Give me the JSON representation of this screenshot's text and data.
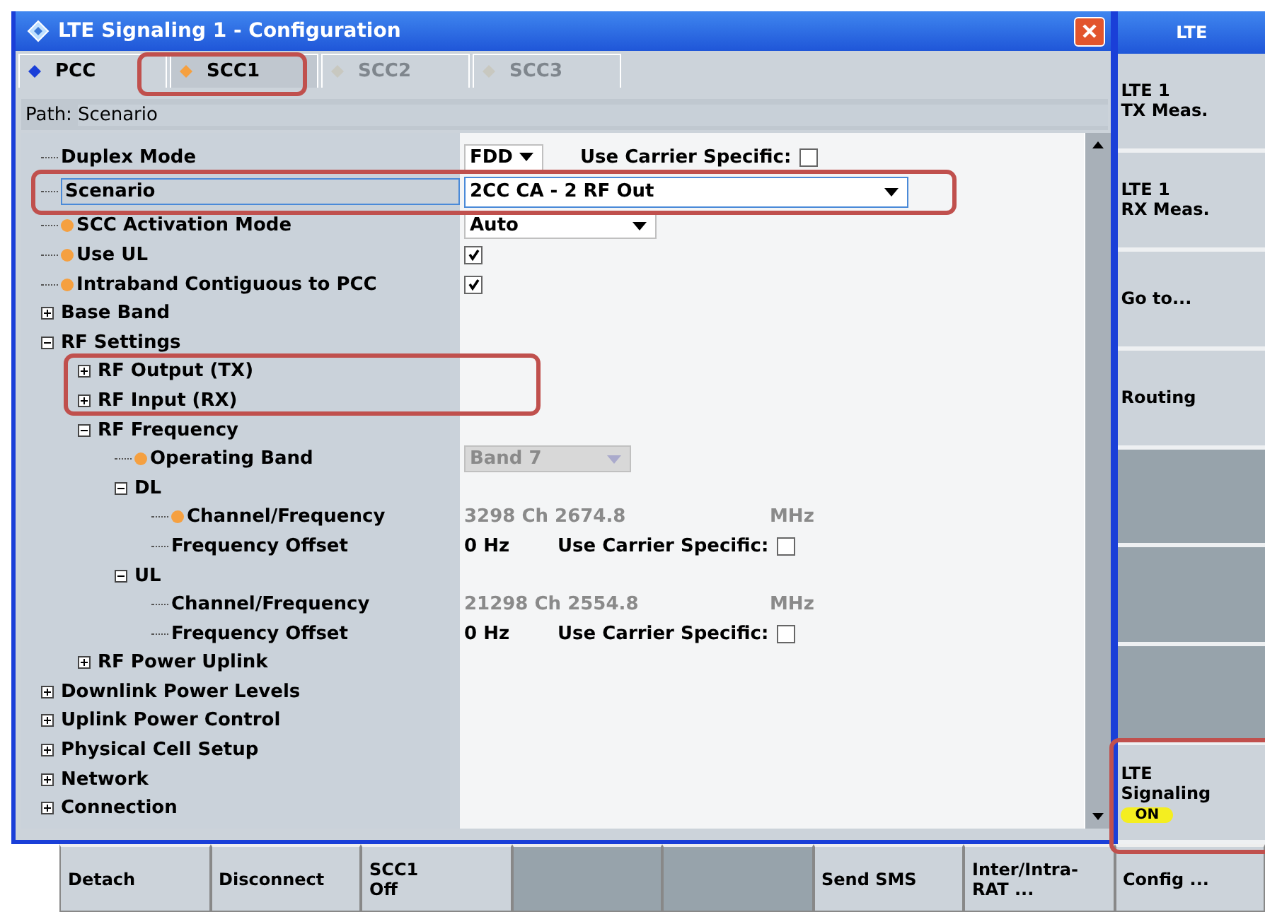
{
  "window": {
    "title": "LTE Signaling 1 - Configuration"
  },
  "tabs": [
    {
      "label": "PCC",
      "selected": false,
      "disabled": false,
      "color": "#1a3fd8"
    },
    {
      "label": "SCC1",
      "selected": true,
      "disabled": false,
      "color": "#f5a040"
    },
    {
      "label": "SCC2",
      "selected": false,
      "disabled": true,
      "color": "#c8c8c0"
    },
    {
      "label": "SCC3",
      "selected": false,
      "disabled": true,
      "color": "#c8c8c0"
    }
  ],
  "path": {
    "label": "Path:",
    "value": "Scenario"
  },
  "tree": [
    {
      "label": "Duplex Mode",
      "marked": false,
      "selected": false,
      "control": {
        "kind": "small-dropdown",
        "value": "FDD",
        "carrier_specific": {
          "label": "Use Carrier Specific:",
          "checked": false
        }
      }
    },
    {
      "label": "Scenario",
      "marked": false,
      "selected": true,
      "control": {
        "kind": "wide-dropdown",
        "value": "2CC CA - 2 RF Out"
      }
    },
    {
      "label": "SCC Activation Mode",
      "marked": true,
      "selected": false,
      "control": {
        "kind": "dropdown",
        "value": "Auto",
        "disabled": false
      }
    },
    {
      "label": "Use UL",
      "marked": true,
      "selected": false,
      "control": {
        "kind": "checkbox",
        "checked": true
      }
    },
    {
      "label": "Intraband Contiguous to PCC",
      "marked": true,
      "selected": false,
      "control": {
        "kind": "checkbox",
        "checked": true
      }
    },
    {
      "label": "Base Band",
      "marked": false,
      "selected": false,
      "expanded": false
    },
    {
      "label": "RF Settings",
      "marked": false,
      "selected": false,
      "expanded": true,
      "children": [
        {
          "label": "RF Output (TX)",
          "marked": false,
          "selected": false,
          "expanded": false
        },
        {
          "label": "RF Input (RX)",
          "marked": false,
          "selected": false,
          "expanded": false
        },
        {
          "label": "RF Frequency",
          "marked": false,
          "selected": false,
          "expanded": true,
          "children": [
            {
              "label": "Operating Band",
              "marked": true,
              "selected": false,
              "control": {
                "kind": "dropdown",
                "value": "Band 7",
                "disabled": true
              }
            },
            {
              "label": "DL",
              "marked": false,
              "selected": false,
              "expanded": true,
              "children": [
                {
                  "label": "Channel/Frequency",
                  "marked": true,
                  "selected": false,
                  "control": {
                    "kind": "readout",
                    "value": "3298 Ch 2674.8",
                    "unit": "MHz"
                  }
                },
                {
                  "label": "Frequency Offset",
                  "marked": false,
                  "selected": false,
                  "control": {
                    "kind": "offset",
                    "value": "0 Hz",
                    "carrier_specific": {
                      "label": "Use Carrier Specific:",
                      "checked": false
                    }
                  }
                }
              ]
            },
            {
              "label": "UL",
              "marked": false,
              "selected": false,
              "expanded": true,
              "children": [
                {
                  "label": "Channel/Frequency",
                  "marked": false,
                  "selected": false,
                  "control": {
                    "kind": "readout",
                    "value": "21298 Ch 2554.8",
                    "unit": "MHz"
                  }
                },
                {
                  "label": "Frequency Offset",
                  "marked": false,
                  "selected": false,
                  "control": {
                    "kind": "offset",
                    "value": "0 Hz",
                    "carrier_specific": {
                      "label": "Use Carrier Specific:",
                      "checked": false
                    }
                  }
                }
              ]
            }
          ]
        },
        {
          "label": "RF Power Uplink",
          "marked": false,
          "selected": false,
          "expanded": false
        }
      ]
    },
    {
      "label": "Downlink Power Levels",
      "marked": false,
      "selected": false,
      "expanded": false
    },
    {
      "label": "Uplink Power Control",
      "marked": false,
      "selected": false,
      "expanded": false
    },
    {
      "label": "Physical Cell Setup",
      "marked": false,
      "selected": false,
      "expanded": false
    },
    {
      "label": "Network",
      "marked": false,
      "selected": false,
      "expanded": false
    },
    {
      "label": "Connection",
      "marked": false,
      "selected": false,
      "expanded": false
    }
  ],
  "side_panel": {
    "title": "LTE",
    "buttons": [
      {
        "kind": "button",
        "lines": [
          "LTE 1",
          "TX Meas."
        ]
      },
      {
        "kind": "button",
        "lines": [
          "LTE 1",
          "RX Meas."
        ]
      },
      {
        "kind": "button",
        "lines": [
          "Go to..."
        ]
      },
      {
        "kind": "button",
        "lines": [
          "Routing"
        ]
      },
      {
        "kind": "blank"
      },
      {
        "kind": "blank"
      },
      {
        "kind": "blank"
      },
      {
        "kind": "toggle",
        "lines": [
          "LTE",
          "Signaling"
        ],
        "state": "ON",
        "on": true
      }
    ]
  },
  "bottom_bar": [
    {
      "kind": "button",
      "lines": [
        "Detach"
      ]
    },
    {
      "kind": "button",
      "lines": [
        "Disconnect"
      ]
    },
    {
      "kind": "button",
      "lines": [
        "SCC1",
        "Off"
      ]
    },
    {
      "kind": "blank"
    },
    {
      "kind": "blank"
    },
    {
      "kind": "button",
      "lines": [
        "Send SMS"
      ]
    },
    {
      "kind": "button",
      "lines": [
        "Inter/Intra-",
        "RAT ..."
      ]
    },
    {
      "kind": "button",
      "lines": [
        "Config ..."
      ]
    }
  ]
}
